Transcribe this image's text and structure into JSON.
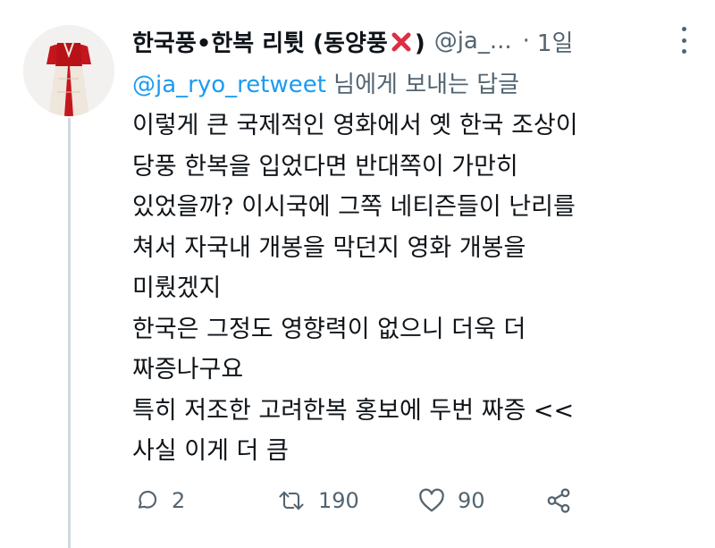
{
  "tweet": {
    "display_name": "한국풍•한복 리튓 (동양풍",
    "display_name_suffix": ")",
    "handle": "@ja_...",
    "time_sep": "·",
    "time": "1일",
    "reply_prefix": "@ja_ryo_retweet",
    "reply_suffix": " 님에게 보내는 답글",
    "text": "이렇게 큰 국제적인 영화에서 옛 한국 조상이\n당풍 한복을 입었다면 반대쪽이 가만히\n있었을까? 이시국에 그쪽 네티즌들이 난리를\n쳐서 자국내 개봉을 막던지 영화 개봉을\n미뤘겠지\n한국은 그정도 영향력이 없으니 더욱 더\n짜증나구요\n특히 저조한 고려한복 홍보에 두번 짜증 <<\n사실 이게 더 큼"
  },
  "actions": {
    "reply_count": "2",
    "retweet_count": "190",
    "like_count": "90"
  },
  "icons": {
    "avatar": "hanbok-figure-avatar",
    "name_emoji": "red-cross-mark",
    "more": "vertical-ellipsis-icon",
    "reply": "reply-icon",
    "retweet": "retweet-icon",
    "like": "heart-icon",
    "share": "share-icon"
  },
  "colors": {
    "accent": "#1d9bf0",
    "secondary_text": "#536471",
    "thread_line": "#cfd9de",
    "cross_mark": "#dd2e44"
  }
}
